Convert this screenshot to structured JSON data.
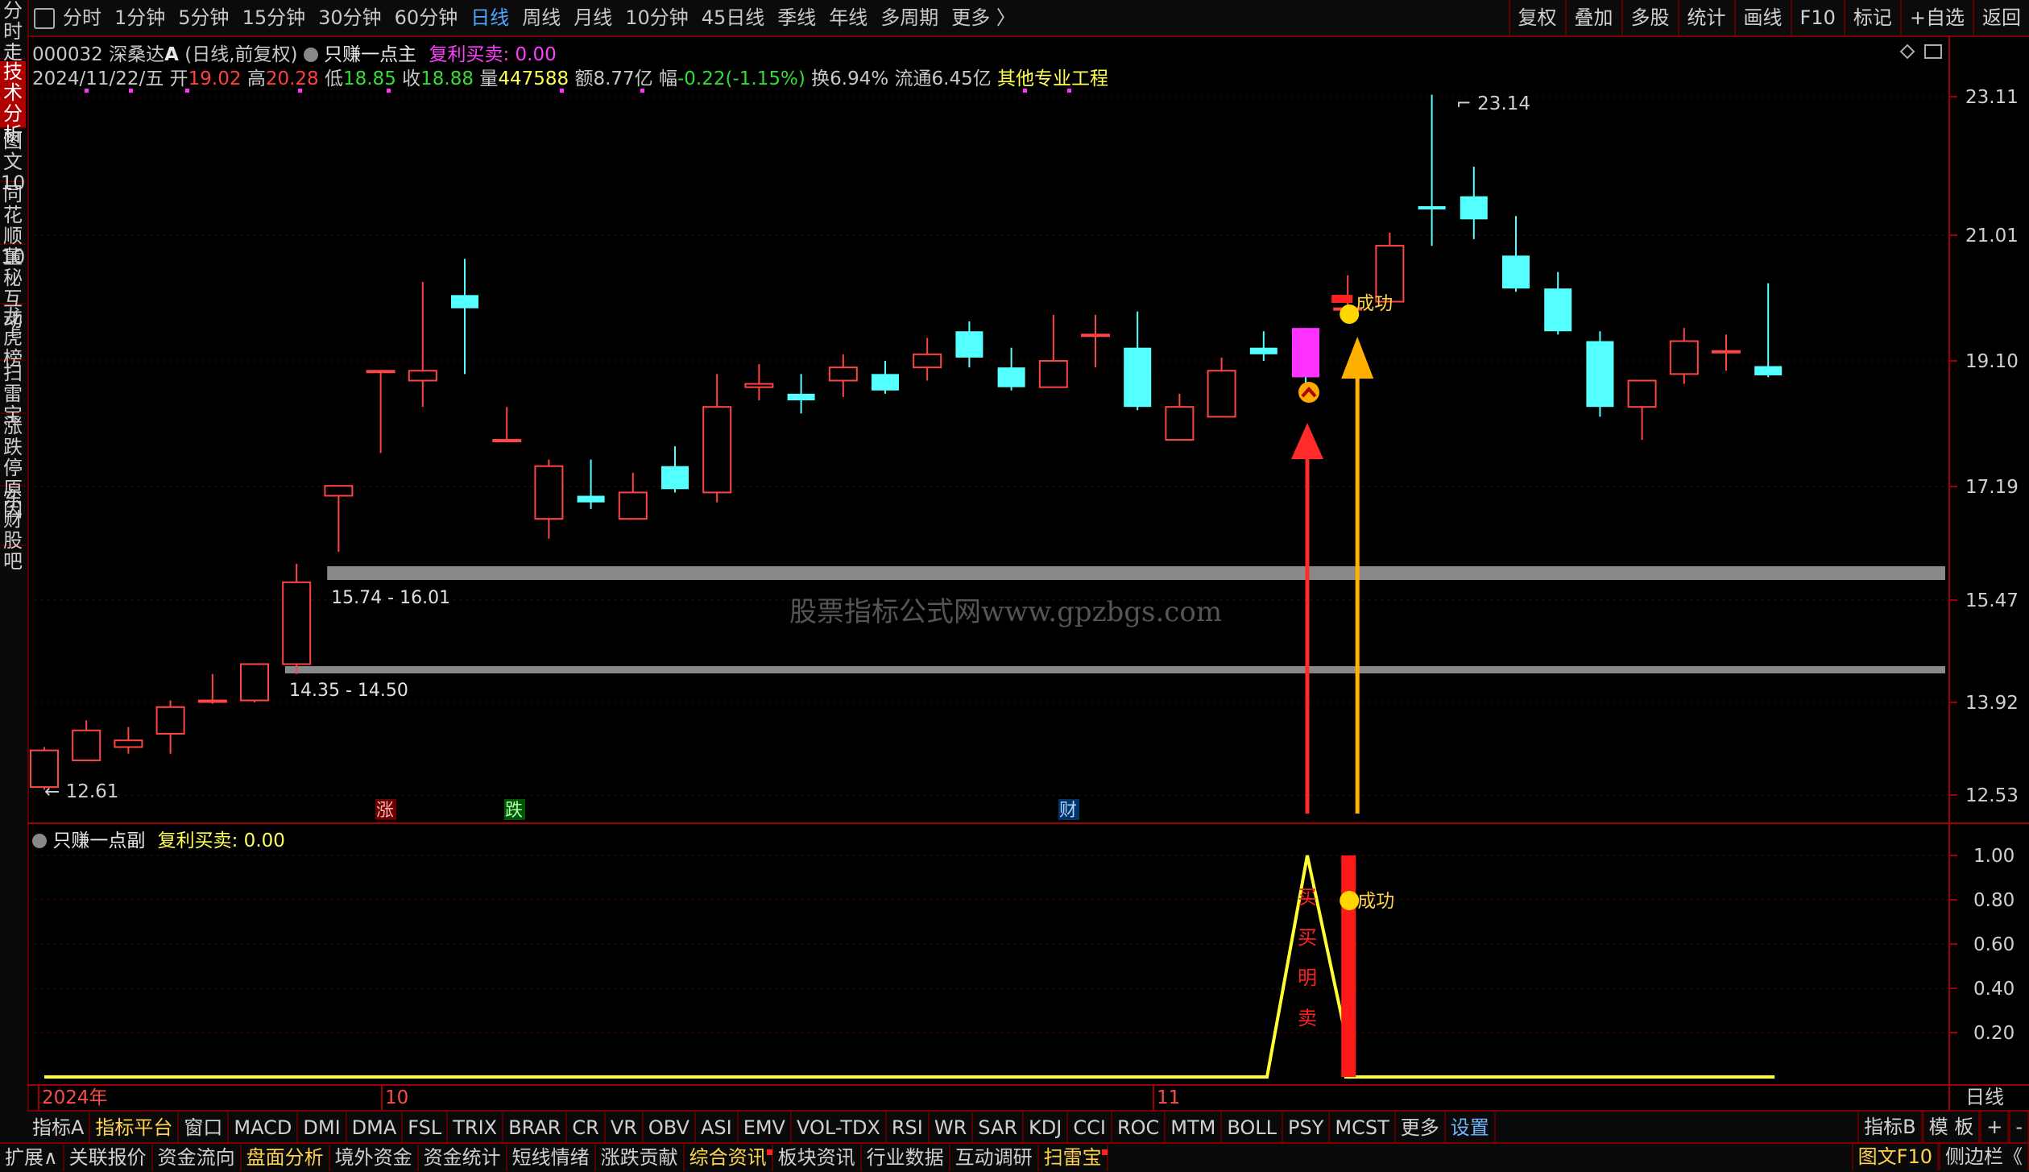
{
  "toolbar": {
    "periods": [
      "分时",
      "1分钟",
      "5分钟",
      "15分钟",
      "30分钟",
      "60分钟",
      "日线",
      "周线",
      "月线",
      "10分钟",
      "45日线",
      "季线",
      "年线",
      "多周期",
      "更多 〉"
    ],
    "active_period": "日线",
    "tools": [
      "复权",
      "叠加",
      "多股",
      "统计",
      "画线",
      "F10",
      "标记",
      "+自选",
      "返回"
    ]
  },
  "sidebar": [
    "分时走势",
    "技术分析",
    "图文10",
    "同花顺10",
    "董秘互动",
    "龙虎榜",
    "扫雷宝",
    "涨跌停原因",
    "东财股吧"
  ],
  "sidebar_active": "技术分析",
  "stock": {
    "code": "000032",
    "name": "深桑达",
    "badge": "A",
    "mode": "(日线,前复权)",
    "indicator_main": "只赚一点主",
    "indicator_value": "复利买卖: 0.00",
    "date": "2024/11/22/五",
    "open_label": "开",
    "open": "19.02",
    "high_label": "高",
    "high": "20.28",
    "low_label": "低",
    "low": "18.85",
    "close_label": "收",
    "close": "18.88",
    "vol_label": "量",
    "vol": "447588",
    "amount_label": "额",
    "amount": "8.77亿",
    "chg_label": "幅",
    "chg": "-0.22(-1.15%)",
    "turnover": "换6.94%",
    "float_cap": "流通6.45亿",
    "sector": "其他专业工程"
  },
  "sub_panel": {
    "title": "只赚一点副",
    "value": "复利买卖: 0.00"
  },
  "chart_data": {
    "type": "candlestick",
    "price_axis_ticks": [
      23.11,
      21.01,
      19.1,
      17.19,
      15.47,
      13.92,
      12.53
    ],
    "price_axis_labels": [
      "23.11",
      "21.01",
      "19.10",
      "17.19",
      "15.47",
      "13.92",
      "12.53"
    ],
    "sub_axis_labels": [
      "1.00",
      "0.80",
      "0.60",
      "0.40",
      "0.20"
    ],
    "x_labels": [
      "2024年",
      "10",
      "11"
    ],
    "candles": [
      {
        "o": 12.65,
        "h": 13.25,
        "l": 12.61,
        "c": 13.2
      },
      {
        "o": 13.05,
        "h": 13.65,
        "l": 13.05,
        "c": 13.5
      },
      {
        "o": 13.25,
        "h": 13.55,
        "l": 13.15,
        "c": 13.35
      },
      {
        "o": 13.45,
        "h": 13.95,
        "l": 13.15,
        "c": 13.85
      },
      {
        "o": 13.95,
        "h": 14.35,
        "l": 13.9,
        "c": 13.95
      },
      {
        "o": 13.95,
        "h": 14.5,
        "l": 13.92,
        "c": 14.5
      },
      {
        "o": 14.5,
        "h": 16.02,
        "l": 14.35,
        "c": 15.74
      },
      {
        "o": 17.05,
        "h": 17.2,
        "l": 16.2,
        "c": 17.2
      },
      {
        "o": 18.95,
        "h": 18.95,
        "l": 17.7,
        "c": 18.95
      },
      {
        "o": 18.8,
        "h": 20.3,
        "l": 18.4,
        "c": 18.95
      },
      {
        "o": 20.1,
        "h": 20.65,
        "l": 18.9,
        "c": 19.9
      },
      {
        "o": 17.9,
        "h": 18.4,
        "l": 17.9,
        "c": 17.9
      },
      {
        "o": 16.7,
        "h": 17.6,
        "l": 16.4,
        "c": 17.5
      },
      {
        "o": 17.05,
        "h": 17.6,
        "l": 16.85,
        "c": 16.95
      },
      {
        "o": 16.7,
        "h": 17.4,
        "l": 16.7,
        "c": 17.1
      },
      {
        "o": 17.5,
        "h": 17.8,
        "l": 17.1,
        "c": 17.15
      },
      {
        "o": 17.1,
        "h": 18.9,
        "l": 16.95,
        "c": 18.4
      },
      {
        "o": 18.7,
        "h": 19.05,
        "l": 18.5,
        "c": 18.75
      },
      {
        "o": 18.6,
        "h": 18.9,
        "l": 18.3,
        "c": 18.5
      },
      {
        "o": 18.8,
        "h": 19.2,
        "l": 18.55,
        "c": 19.0
      },
      {
        "o": 18.9,
        "h": 19.1,
        "l": 18.6,
        "c": 18.65
      },
      {
        "o": 19.0,
        "h": 19.45,
        "l": 18.8,
        "c": 19.2
      },
      {
        "o": 19.55,
        "h": 19.7,
        "l": 19.0,
        "c": 19.15
      },
      {
        "o": 19.0,
        "h": 19.3,
        "l": 18.65,
        "c": 18.7
      },
      {
        "o": 18.7,
        "h": 19.8,
        "l": 18.7,
        "c": 19.1
      },
      {
        "o": 19.5,
        "h": 19.8,
        "l": 19.0,
        "c": 19.5
      },
      {
        "o": 19.3,
        "h": 19.85,
        "l": 18.35,
        "c": 18.4
      },
      {
        "o": 17.9,
        "h": 18.6,
        "l": 17.9,
        "c": 18.4
      },
      {
        "o": 18.25,
        "h": 19.15,
        "l": 18.25,
        "c": 18.95
      },
      {
        "o": 19.3,
        "h": 19.55,
        "l": 19.1,
        "c": 19.2
      },
      {
        "o": 19.6,
        "h": 19.6,
        "l": 18.75,
        "c": 18.85
      },
      {
        "o": 19.9,
        "h": 20.4,
        "l": 19.9,
        "c": 19.9
      },
      {
        "o": 20.0,
        "h": 21.05,
        "l": 20.0,
        "c": 20.85
      },
      {
        "o": 21.45,
        "h": 23.14,
        "l": 20.85,
        "c": 21.4
      },
      {
        "o": 21.6,
        "h": 22.05,
        "l": 20.95,
        "c": 21.25
      },
      {
        "o": 20.7,
        "h": 21.3,
        "l": 20.15,
        "c": 20.2
      },
      {
        "o": 20.2,
        "h": 20.45,
        "l": 19.5,
        "c": 19.55
      },
      {
        "o": 19.4,
        "h": 19.55,
        "l": 18.25,
        "c": 18.4
      },
      {
        "o": 18.4,
        "h": 18.8,
        "l": 17.9,
        "c": 18.8
      },
      {
        "o": 18.9,
        "h": 19.6,
        "l": 18.75,
        "c": 19.4
      },
      {
        "o": 19.25,
        "h": 19.5,
        "l": 18.95,
        "c": 19.25
      },
      {
        "o": 19.02,
        "h": 20.28,
        "l": 18.85,
        "c": 18.88
      }
    ],
    "zones": [
      {
        "label": "15.74 - 16.01",
        "low": 15.74,
        "high": 16.01
      },
      {
        "label": "14.35 - 14.50",
        "low": 14.35,
        "high": 14.5
      }
    ],
    "annotations": {
      "high_mark": "23.14",
      "low_mark": "12.61",
      "success_label": "成功",
      "event_tags": [
        "涨",
        "跌",
        "财"
      ],
      "sub_vertical_text": [
        "买",
        "买",
        "明",
        "卖"
      ]
    },
    "sub_series": {
      "name": "",
      "values_nonzero": [
        {
          "index": 30,
          "value": 1.0
        }
      ],
      "bar_index": 31,
      "bar_value": 1.0
    }
  },
  "indicator_tabs": [
    "指标A",
    "指标平台",
    "窗口",
    "MACD",
    "DMI",
    "DMA",
    "FSL",
    "TRIX",
    "BRAR",
    "CR",
    "VR",
    "OBV",
    "ASI",
    "EMV",
    "VOL-TDX",
    "RSI",
    "WR",
    "SAR",
    "KDJ",
    "CCI",
    "ROC",
    "MTM",
    "BOLL",
    "PSY",
    "MCST",
    "更多",
    "设置"
  ],
  "indicator_right": [
    "指标B",
    "模 板",
    "+",
    "-"
  ],
  "bottom_tabs": [
    "扩展∧",
    "关联报价",
    "资金流向",
    "盘面分析",
    "境外资金",
    "资金统计",
    "短线情绪",
    "涨跌贡献",
    "综合资讯",
    "板块资讯",
    "行业数据",
    "互动调研",
    "扫雷宝"
  ],
  "bottom_right": [
    "图文F10",
    "侧边栏《"
  ],
  "period_label": "日线",
  "watermark": "股票指标公式网www.gpzbgs.com",
  "colors": {
    "up": "#ff4444",
    "down": "#54ffff",
    "background": "#000000",
    "accent": "#b00000"
  }
}
